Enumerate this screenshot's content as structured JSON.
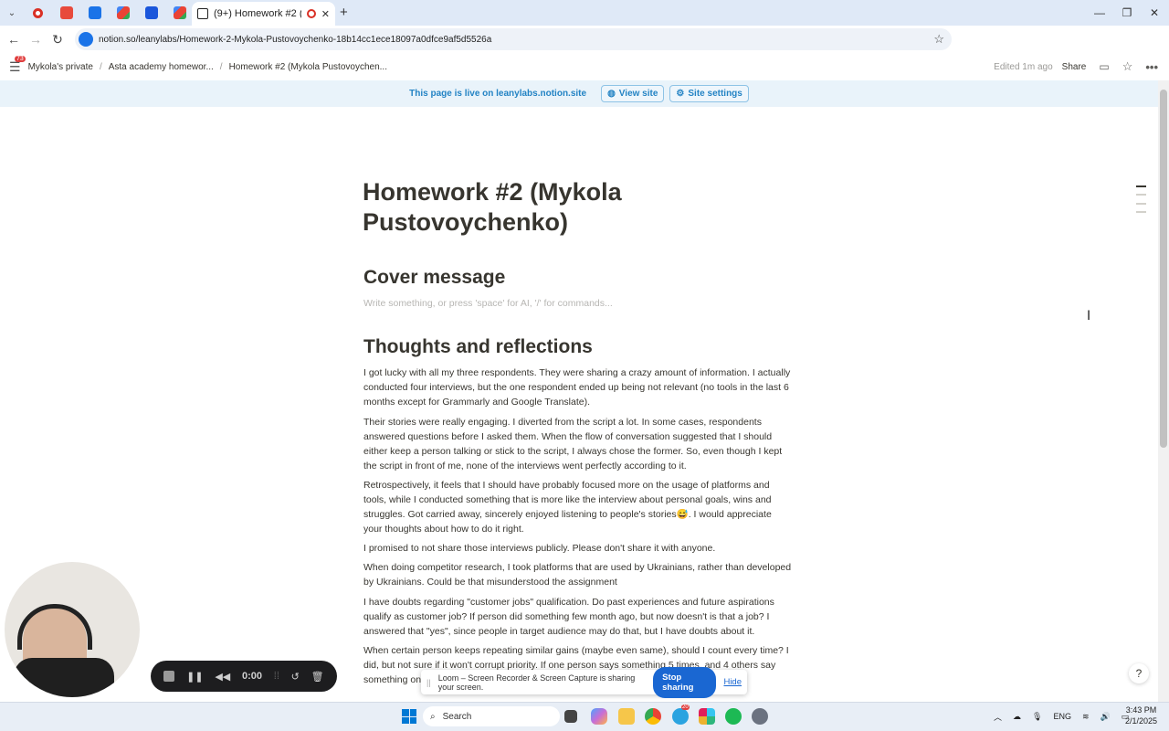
{
  "browser": {
    "active_tab_title": "(9+) Homework #2 (Mykola",
    "new_tab_symbol": "+",
    "url": "notion.so/leanylabs/Homework-2-Mykola-Pustovoychenko-18b14cc1ece18097a0dfce9af5d5526a",
    "tabs": [
      {
        "icon": "record-icon",
        "color": "#d93025"
      },
      {
        "icon": "slides-icon",
        "color": "#e84a3c"
      },
      {
        "icon": "trello-icon",
        "color": "#1a73e8"
      },
      {
        "icon": "gmail-icon",
        "color": "#c5221f"
      },
      {
        "icon": "docs-icon",
        "color": "#1a56db"
      },
      {
        "icon": "gmail-icon",
        "color": "#c5221f"
      }
    ]
  },
  "notion": {
    "notification_badge": "73",
    "breadcrumbs": [
      "Mykola's private",
      "Asta academy homewor...",
      "Homework #2 (Mykola Pustovoychen..."
    ],
    "edited": "Edited 1m ago",
    "share": "Share",
    "banner": {
      "text": "This page is live on leanylabs.notion.site",
      "view_site": "View site",
      "site_settings": "Site settings"
    },
    "page": {
      "title": "Homework #2 (Mykola Pustovoychenko)",
      "h_cover": "Cover message",
      "placeholder": "Write something, or press 'space' for AI, '/' for commands...",
      "h_thoughts": "Thoughts and reflections",
      "paragraphs": [
        "I got lucky with all my three respondents. They were sharing a crazy amount of information. I actually conducted four interviews, but the one respondent ended up being not relevant (no tools in the last 6 months except for Grammarly and Google Translate).",
        "Their stories were really engaging. I diverted from the script a lot. In some cases, respondents answered questions before I asked them. When the flow of conversation suggested that I should either keep a person talking or stick to the script, I always chose the former. So, even though I kept the script in front of me, none of the interviews went perfectly according to it.",
        "Retrospectively, it feels that I should have probably focused more on the usage of platforms and tools, while I conducted something that is more like the interview about personal goals, wins and struggles. Got carried away, sincerely enjoyed listening to people's stories😅. I would appreciate your thoughts about how to do it right.",
        "I promised to not share those interviews publicly. Please don't share it with anyone.",
        "When doing competitor research, I took platforms that are used by Ukrainians, rather than developed by Ukrainians. Could be that misunderstood the assignment",
        "I have doubts regarding \"customer jobs\" qualification. Do past experiences and future aspirations qualify as customer job? If person did something few month ago, but now doesn't is that a job? I answered that \"yes\", since people in target audience may do that, but I have doubts about it.",
        "When certain person keeps repeating similar gains (maybe even same), should I count every time? I did, but not sure if it won't corrupt priority. If one person says something 5 times, and 4 others say something once"
      ]
    }
  },
  "loom": {
    "timer": "0:00",
    "message": "Loom – Screen Recorder & Screen Capture is sharing your screen.",
    "stop": "Stop sharing",
    "hide": "Hide"
  },
  "taskbar": {
    "search": "Search",
    "lang": "ENG",
    "time": "3:43 PM",
    "date": "2/1/2025",
    "badge": "20"
  }
}
